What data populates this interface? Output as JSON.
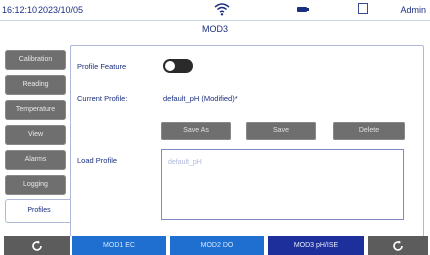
{
  "status": {
    "time": "16:12:10",
    "date": "2023/10/05",
    "user": "Admin",
    "icons": [
      "wifi-icon",
      "battery-icon",
      "storage-icon"
    ]
  },
  "title": "MOD3",
  "sidebar": {
    "items": [
      {
        "label": "Calibration"
      },
      {
        "label": "Reading"
      },
      {
        "label": "Temperature"
      },
      {
        "label": "View"
      },
      {
        "label": "Alarms"
      },
      {
        "label": "Logging"
      },
      {
        "label": "Profiles"
      }
    ],
    "active": "Profiles"
  },
  "profile": {
    "feature_label": "Profile Feature",
    "feature_enabled": false,
    "current_label": "Current Profile:",
    "current_value": "default_pH (Modified)*",
    "load_label": "Load Profile",
    "load_placeholder": "default_pH"
  },
  "buttons": {
    "save_as": "Save As",
    "save": "Save",
    "delete": "Delete"
  },
  "bottom": {
    "tabs": [
      {
        "label": "MOD1 EC"
      },
      {
        "label": "MOD2 DO"
      },
      {
        "label": "MOD3 pH/ISE"
      }
    ],
    "active": "MOD3 pH/ISE"
  },
  "colors": {
    "accent": "#1f6fd0",
    "active_tab": "#1d2f9a",
    "button_gray": "#6f6f6f",
    "text_blue": "#1b2f80"
  }
}
